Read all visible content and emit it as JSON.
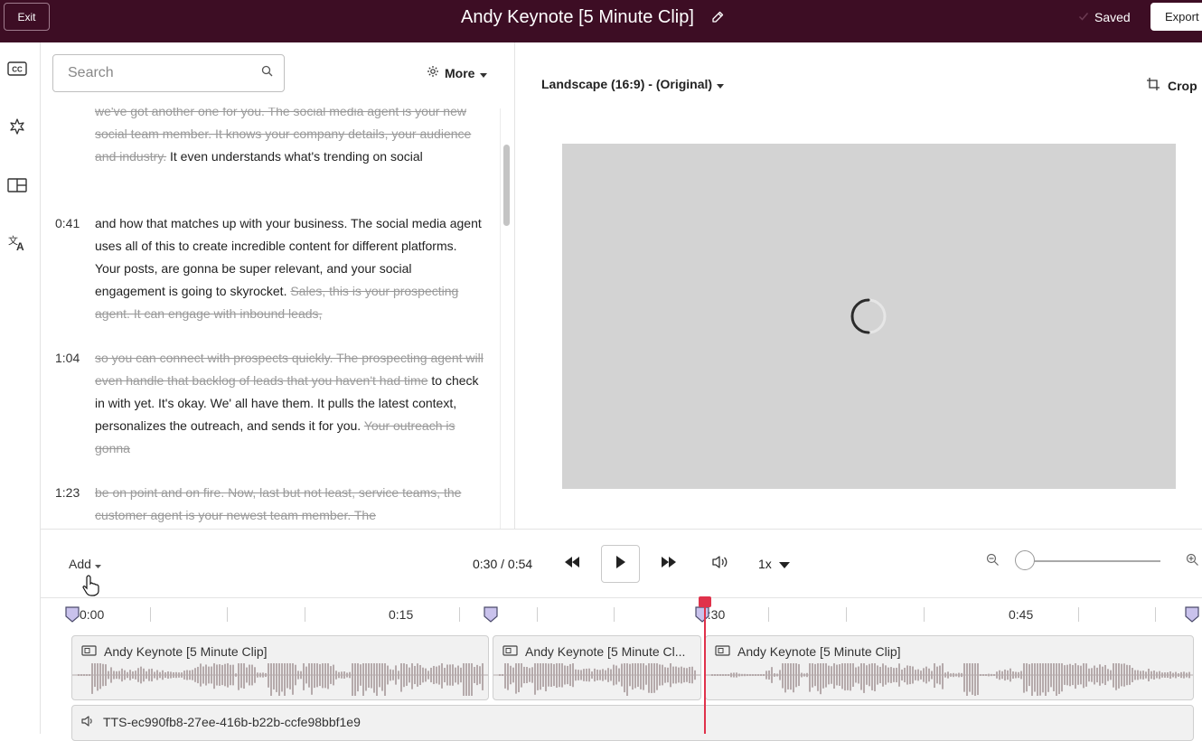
{
  "header": {
    "exit_label": "Exit",
    "title": "Andy Keynote [5 Minute Clip]",
    "saved_label": "Saved",
    "export_label": "Export"
  },
  "left_rail": {
    "icons": [
      "closed-captions-icon",
      "shapes-icon",
      "layout-icon",
      "translate-icon"
    ]
  },
  "transcript": {
    "search_placeholder": "Search",
    "more_label": "More",
    "segments": [
      {
        "time": "",
        "parts": [
          {
            "text": "we've got another one for you. The social media agent is your new social team member. It knows your company details, your audience and industry.",
            "struck": true
          },
          {
            "text": " It even understands what's trending on social",
            "struck": false
          }
        ]
      },
      {
        "time": "0:41",
        "parts": [
          {
            "text": "and how that matches up with your business. The social media agent uses all of this to create incredible content for different platforms. Your posts, are gonna be super relevant, and your social engagement is going to skyrocket. ",
            "struck": false
          },
          {
            "text": "Sales, this is your prospecting agent. It can engage with inbound leads,",
            "struck": true
          }
        ]
      },
      {
        "time": "1:04",
        "parts": [
          {
            "text": "so you can connect with prospects quickly. The prospecting agent will even handle that backlog of leads that you haven't had time",
            "struck": true
          },
          {
            "text": " to check in with yet. It's okay. We' all have them. It pulls the latest context, personalizes the outreach, and sends it for you. ",
            "struck": false
          },
          {
            "text": "Your outreach is gonna",
            "struck": true
          }
        ]
      },
      {
        "time": "1:23",
        "parts": [
          {
            "text": "be on point and on fire. Now, last but not least, service teams, the customer agent is your newest team member. The",
            "struck": true
          }
        ]
      }
    ]
  },
  "preview": {
    "aspect_label": "Landscape (16:9) - (Original)",
    "crop_label": "Crop"
  },
  "controls": {
    "add_label": "Add",
    "current_time": "0:30",
    "duration": "0:54",
    "timecode": "0:30 / 0:54",
    "speed_label": "1x",
    "zoom_level": 0.03,
    "playback_progress": 0.555
  },
  "timeline": {
    "ruler_labels": [
      "0:00",
      "0:15",
      "0:30",
      "0:45"
    ],
    "clips": [
      {
        "label": "Andy Keynote [5 Minute Clip]"
      },
      {
        "label": "Andy Keynote [5 Minute Cl..."
      },
      {
        "label": "Andy Keynote [5 Minute Clip]"
      }
    ],
    "audio_track_label": "TTS-ec990fb8-27ee-416b-b22b-ccfe98bbf1e9"
  },
  "colors": {
    "header_bg": "#3d0d24",
    "playhead": "#e0324b",
    "marker": "#c9c2ec",
    "video_placeholder": "#d3d3d3"
  }
}
